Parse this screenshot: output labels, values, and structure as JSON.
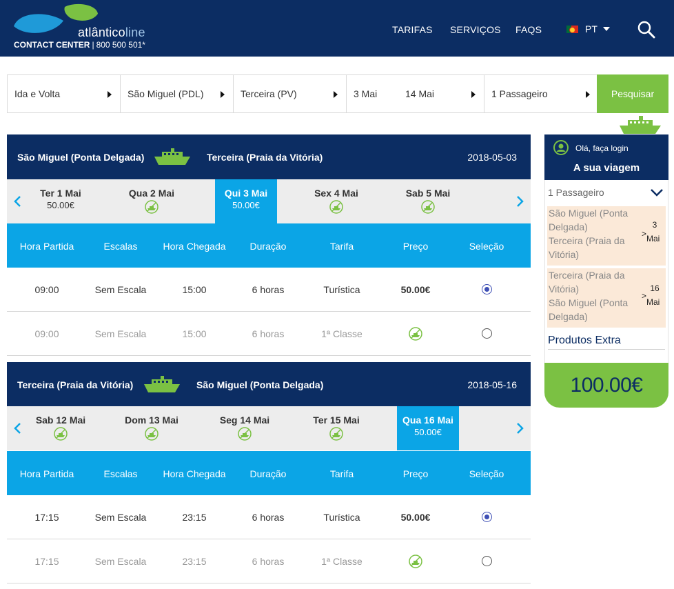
{
  "header": {
    "logo_text": "atlântico",
    "logo_text_suffix": "line",
    "contact_center_label": "CONTACT CENTER",
    "contact_phone": "800 500 501*",
    "nav": [
      "TARIFAS",
      "SERVIÇOS",
      "FAQS"
    ],
    "language": "PT"
  },
  "search": {
    "trip_type": "Ida e Volta",
    "origin": "São Miguel (PDL)",
    "destination": "Terceira (PV)",
    "depart_date": "3 Mai",
    "return_date": "14 Mai",
    "passengers": "1 Passageiro",
    "submit_label": "Pesquisar"
  },
  "columns": [
    "Hora Partida",
    "Escalas",
    "Hora Chegada",
    "Duração",
    "Tarifa",
    "Preço",
    "Seleção"
  ],
  "outbound": {
    "from": "São Miguel (Ponta Delgada)",
    "to": "Terceira (Praia da Vitória)",
    "date": "2018-05-03",
    "days": [
      {
        "label": "Ter 1 Mai",
        "price": "50.00€",
        "available": true,
        "active": false
      },
      {
        "label": "Qua 2 Mai",
        "price": "",
        "available": false,
        "active": false
      },
      {
        "label": "Qui 3 Mai",
        "price": "50.00€",
        "available": true,
        "active": true
      },
      {
        "label": "Sex 4 Mai",
        "price": "",
        "available": false,
        "active": false
      },
      {
        "label": "Sab 5 Mai",
        "price": "",
        "available": false,
        "active": false
      }
    ],
    "rows": [
      {
        "depart": "09:00",
        "stops": "Sem Escala",
        "arrive": "15:00",
        "duration": "6 horas",
        "fare": "Turística",
        "price": "50.00€",
        "selected": true,
        "available": true
      },
      {
        "depart": "09:00",
        "stops": "Sem Escala",
        "arrive": "15:00",
        "duration": "6 horas",
        "fare": "1ª Classe",
        "price": "",
        "selected": false,
        "available": false
      }
    ]
  },
  "inbound": {
    "from": "Terceira (Praia da Vitória)",
    "to": "São Miguel (Ponta Delgada)",
    "date": "2018-05-16",
    "days": [
      {
        "label": "Sab 12 Mai",
        "price": "",
        "available": false,
        "active": false
      },
      {
        "label": "Dom 13 Mai",
        "price": "",
        "available": false,
        "active": false
      },
      {
        "label": "Seg 14 Mai",
        "price": "",
        "available": false,
        "active": false
      },
      {
        "label": "Ter 15 Mai",
        "price": "",
        "available": false,
        "active": false
      },
      {
        "label": "Qua 16 Mai",
        "price": "50.00€",
        "available": true,
        "active": true
      }
    ],
    "rows": [
      {
        "depart": "17:15",
        "stops": "Sem Escala",
        "arrive": "23:15",
        "duration": "6 horas",
        "fare": "Turística",
        "price": "50.00€",
        "selected": true,
        "available": true
      },
      {
        "depart": "17:15",
        "stops": "Sem Escala",
        "arrive": "23:15",
        "duration": "6 horas",
        "fare": "1ª Classe",
        "price": "",
        "selected": false,
        "available": false
      }
    ]
  },
  "sidebar": {
    "login_text": "Olá, faça login",
    "title": "A sua viagem",
    "passengers": "1 Passageiro",
    "legs": [
      {
        "from": "São Miguel (Ponta Delgada)",
        "to": "Terceira (Praia da Vitória)",
        "day": "3",
        "month": "Mai"
      },
      {
        "from": "Terceira (Praia da Vitória)",
        "to": "São Miguel (Ponta Delgada)",
        "day": "16",
        "month": "Mai"
      }
    ],
    "extras_label": "Produtos Extra",
    "total": "100.00€"
  },
  "colors": {
    "navy": "#0c2d63",
    "cyan": "#0ba5e6",
    "green": "#7bc143",
    "peach": "#fbe9d8",
    "radio": "#3e4fb5"
  }
}
